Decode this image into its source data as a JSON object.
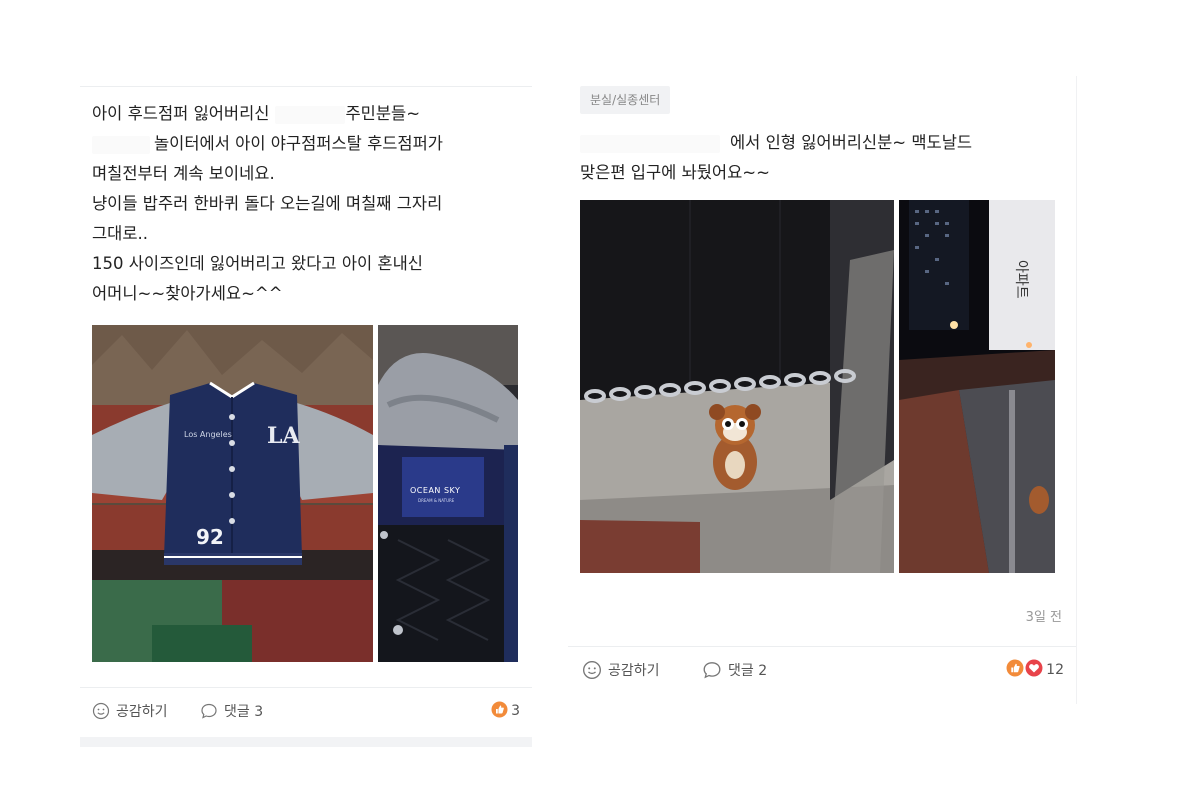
{
  "posts": [
    {
      "text_lines": [
        "아이 후드점퍼 잃어버리신",
        "주민분들~",
        "놀이터에서 아이 야구점퍼스탈 후드점퍼가",
        "며칠전부터 계속 보이네요.",
        "냥이들 밥주러 한바퀴 돌다 오는길에 며칠째 그자리",
        "그대로..",
        "150 사이즈인데 잃어버리고 왔다고 아이 혼내신",
        "어머니~~찾아가세요~^^"
      ],
      "photo_labels": {
        "jacket_number": "92",
        "brand_main": "OCEAN SKY",
        "brand_sub": "DREAM & NATURE"
      },
      "actions": {
        "empathize": "공감하기",
        "comment": "댓글 3"
      },
      "reaction_count": "3"
    },
    {
      "category": "분실/실종센터",
      "text_lines": [
        "에서 인형 잃어버리신분~ 맥도날드",
        "맞은편 입구에 놔뒀어요~~"
      ],
      "timestamp": "3일 전",
      "actions": {
        "empathize": "공감하기",
        "comment": "댓글 2"
      },
      "reaction_count": "12"
    }
  ],
  "colors": {
    "like": "#f28b3a",
    "heart": "#e8434a",
    "jacket_navy": "#1f2d5c",
    "sleeve_gray": "#a7adb4"
  }
}
